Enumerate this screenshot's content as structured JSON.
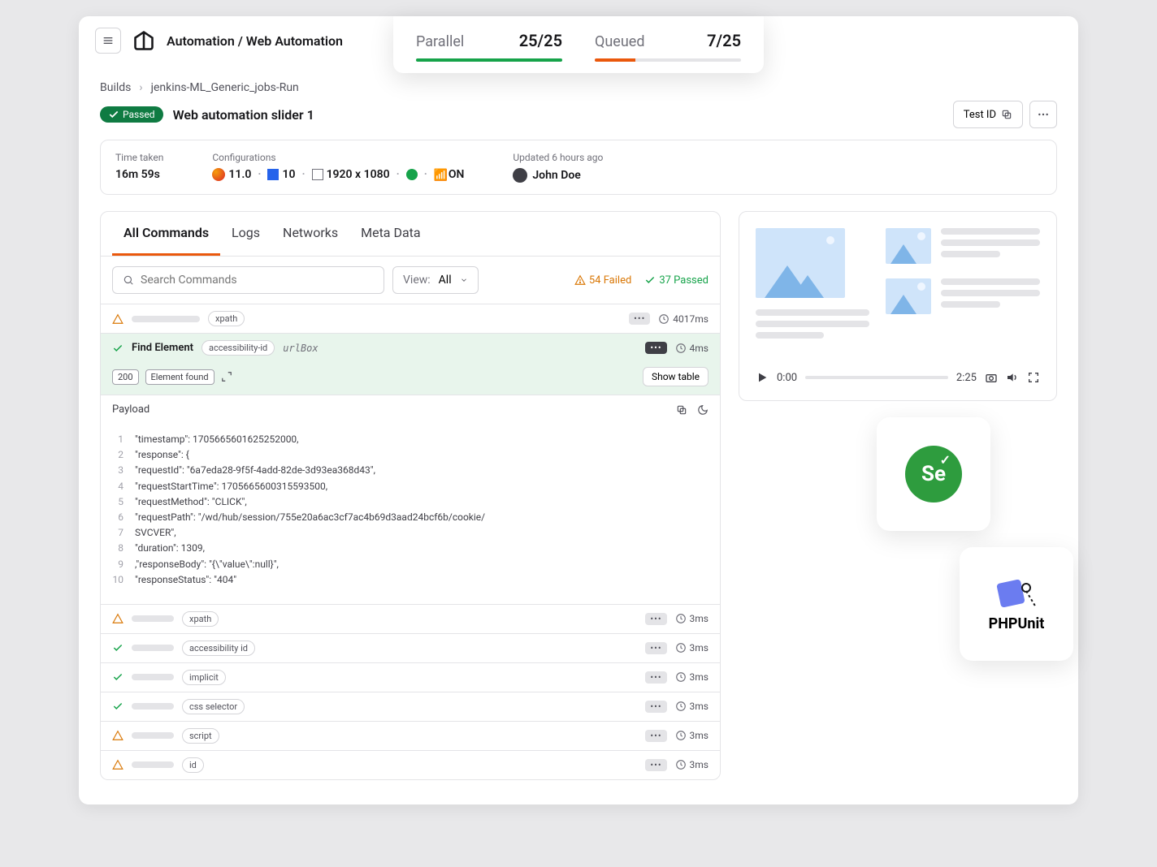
{
  "header": {
    "title": "Automation / Web Automation"
  },
  "stats": {
    "parallel_label": "Parallel",
    "parallel_value": "25/25",
    "queued_label": "Queued",
    "queued_value": "7/25"
  },
  "breadcrumb": {
    "root": "Builds",
    "current": "jenkins-ML_Generic_jobs-Run"
  },
  "session": {
    "status": "Passed",
    "name": "Web automation slider 1",
    "test_id_label": "Test ID"
  },
  "meta": {
    "time_label": "Time taken",
    "time_value": "16m 59s",
    "config_label": "Configurations",
    "browser_ver": "11.0",
    "os_ver": "10",
    "resolution": "1920 x 1080",
    "network": "ON",
    "updated": "Updated 6 hours ago",
    "user": "John Doe"
  },
  "tabs": {
    "t0": "All Commands",
    "t1": "Logs",
    "t2": "Networks",
    "t3": "Meta Data"
  },
  "filter": {
    "search_placeholder": "Search Commands",
    "view_prefix": "View:",
    "view_value": "All",
    "failed": "54 Failed",
    "passed": "37 Passed"
  },
  "commands": {
    "r1_tag": "xpath",
    "r1_time": "4017ms",
    "r2_label": "Find Element",
    "r2_tag": "accessibility-id",
    "r2_url": "urlBox",
    "r2_time": "4ms",
    "result_code": "200",
    "result_text": "Element found",
    "show_table": "Show table",
    "r3_tag": "xpath",
    "r3_time": "3ms",
    "r4_tag": "accessibility id",
    "r4_time": "3ms",
    "r5_tag": "implicit",
    "r5_time": "3ms",
    "r6_tag": "css selector",
    "r6_time": "3ms",
    "r7_tag": "script",
    "r7_time": "3ms",
    "r8_tag": "id",
    "r8_time": "3ms"
  },
  "payload": {
    "title": "Payload",
    "lines": {
      "l1": "\"timestamp\": 170566560162525200­0,",
      "l2": "   \"response\": {",
      "l3": "      \"requestId\": \"6a7eda28-9f5f-4add-82de-3d93ea368d43\",",
      "l4": "      \"requestStartTime\": 1705665600315593500,",
      "l5": "      \"requestMethod\": \"CLICK\",",
      "l6": "      \"requestPath\": \"/wd/hub/session/755e20a6ac3cf7ac4b69d3aad24bcf6b/cookie/",
      "l7": "                     SVCVER\",",
      "l8": "      \"duration\": 1309,",
      "l9": "      ,\"responseBody\": \"{\\\"value\\\":null}\",",
      "l10": "      \"responseStatus\": \"404\""
    }
  },
  "video": {
    "current": "0:00",
    "total": "2:25"
  },
  "logos": {
    "selenium": "Se",
    "phpunit": "PHPUnit"
  }
}
